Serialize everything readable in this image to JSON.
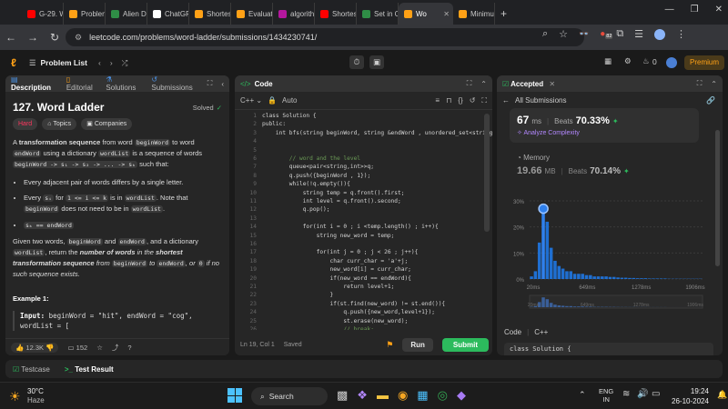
{
  "browser": {
    "tabs": [
      {
        "label": "G-29. W",
        "color": "#ff0000"
      },
      {
        "label": "Problem",
        "color": "#ffa116"
      },
      {
        "label": "Alien Dic",
        "color": "#2f8d46"
      },
      {
        "label": "ChatGPT",
        "color": "#ffffff"
      },
      {
        "label": "Shortest",
        "color": "#ffa116"
      },
      {
        "label": "Evaluati",
        "color": "#ffa116"
      },
      {
        "label": "algorith",
        "color": "#b5179e"
      },
      {
        "label": "Shortest",
        "color": "#ff0000"
      },
      {
        "label": "Set in C",
        "color": "#2f8d46"
      },
      {
        "label": "Wo",
        "color": "#ffa116",
        "active": true
      },
      {
        "label": "Minimu",
        "color": "#ffa116"
      }
    ],
    "url": "leetcode.com/problems/word-ladder/submissions/1434230741/",
    "ext_badge": "82"
  },
  "lc": {
    "problem_list": "Problem List",
    "premium": "Premium",
    "streak": "0"
  },
  "desc": {
    "tabs": [
      "Description",
      "Editorial",
      "Solutions",
      "Submissions"
    ],
    "title": "127. Word Ladder",
    "solved": "Solved",
    "difficulty": "Hard",
    "topics": "Topics",
    "companies": "Companies",
    "p1_a": "A ",
    "p1_b": "transformation sequence",
    "p1_c": " from word ",
    "begin": "beginWord",
    "to_word": " to word",
    "end": "endWord",
    "p1_d": " using a dictionary ",
    "wl": "wordList",
    "p1_e": " is a sequence of words",
    "seq": "beginWord -> s₁ -> s₂ -> ... -> sₖ",
    "such": " such that:",
    "b1": "Every adjacent pair of words differs by a single letter.",
    "b2_a": "Every ",
    "b2_s": "sᵢ",
    "b2_b": " for ",
    "b2_r": "1 <= i <= k",
    "b2_c": " is in ",
    "b2_d": ". Note that",
    "b2_e": " does not need to be in ",
    "b3": "sₖ == endWord",
    "p2_a": "Given two words, ",
    "p2_and": " and ",
    "p2_b": ", and a dictionary",
    "p2_c": ", return the ",
    "p2_bold": "number of words",
    "p2_d": " in the ",
    "p2_bold2": "shortest transformation sequence",
    "p2_e": " from ",
    "p2_f": " to ",
    "p2_g": ", or ",
    "zero": "0",
    "p2_h": " if no such sequence exists.",
    "ex": "Example 1:",
    "ex_in_label": "Input:",
    "ex_in": " beginWord = \"hit\", endWord = \"cog\",",
    "ex_in2": "wordList = [",
    "likes": "12.3K",
    "comments": "152"
  },
  "code": {
    "title": "Code",
    "lang": "C++",
    "auto": "Auto",
    "status_pos": "Ln 19, Col 1",
    "saved": "Saved",
    "run": "Run",
    "submit": "Submit",
    "lines": [
      {
        "n": "1",
        "t": "class Solution {"
      },
      {
        "n": "2",
        "t": "public:"
      },
      {
        "n": "3",
        "t": "    int bfs(string beginWord, string &endWord , unordered_set<string"
      },
      {
        "n": "4",
        "t": ""
      },
      {
        "n": "5",
        "t": ""
      },
      {
        "n": "6",
        "t": "        // word and the level"
      },
      {
        "n": "7",
        "t": "        queue<pair<string,int>>q;"
      },
      {
        "n": "8",
        "t": "        q.push({beginWord , 1});"
      },
      {
        "n": "9",
        "t": "        while(!q.empty()){"
      },
      {
        "n": "10",
        "t": "            string temp = q.front().first;"
      },
      {
        "n": "11",
        "t": "            int level = q.front().second;"
      },
      {
        "n": "12",
        "t": "            q.pop();"
      },
      {
        "n": "13",
        "t": ""
      },
      {
        "n": "14",
        "t": "            for(int i = 0 ; i <temp.length() ; i++){"
      },
      {
        "n": "15",
        "t": "                string new_word = temp;"
      },
      {
        "n": "16",
        "t": ""
      },
      {
        "n": "17",
        "t": "                for(int j = 0 ; j < 26 ; j++){"
      },
      {
        "n": "18",
        "t": "                    char curr_char = 'a'+j;"
      },
      {
        "n": "19",
        "t": "                    new_word[i] = curr_char;"
      },
      {
        "n": "20",
        "t": "                    if(new_word == endWord){"
      },
      {
        "n": "21",
        "t": "                        return level+1;"
      },
      {
        "n": "22",
        "t": "                    }"
      },
      {
        "n": "23",
        "t": "                    if(st.find(new_word) != st.end()){"
      },
      {
        "n": "24",
        "t": "                        q.push({new_word,level+1});"
      },
      {
        "n": "25",
        "t": "                        st.erase(new_word);"
      },
      {
        "n": "26",
        "t": "                        // break;"
      },
      {
        "n": "27",
        "t": "                    }"
      }
    ]
  },
  "result": {
    "tab": "Accepted",
    "all_subs": "All Submissions",
    "runtime_val": "67",
    "runtime_unit": "ms",
    "beats": "Beats",
    "runtime_beats": "70.33%",
    "analyze": "Analyze Complexity",
    "memory": "Memory",
    "mem_val": "19.66",
    "mem_unit": "MB",
    "mem_beats": "70.14%",
    "code_label": "Code",
    "code_lang": "C++",
    "code_preview": "class Solution {"
  },
  "chart_data": {
    "type": "bar",
    "ylim": [
      0,
      30
    ],
    "yticks": [
      "30%",
      "20%",
      "10%",
      "0%"
    ],
    "xticks": [
      "20ms",
      "649ms",
      "1278ms",
      "1906ms"
    ],
    "values": [
      1,
      3,
      14,
      27,
      22,
      12,
      7,
      5,
      4,
      3,
      3,
      2,
      2,
      2,
      1.5,
      1.5,
      1,
      1,
      1,
      1,
      0.8,
      0.8,
      0.6,
      0.5,
      0.5,
      0.4,
      0.4,
      0.3,
      0.3,
      0.3,
      0.2,
      0.2,
      0.2,
      0.2,
      0.2,
      0.1,
      0.1,
      0.1,
      0.1,
      0.1,
      0.1,
      0.1,
      0.1,
      0.1
    ],
    "marker_index": 3,
    "marker_color": "#2f80ed"
  },
  "bottom": {
    "testcase": "Testcase",
    "testresult": "Test Result"
  },
  "taskbar": {
    "temp": "30°C",
    "weather": "Haze",
    "search": "Search",
    "lang1": "ENG",
    "lang2": "IN",
    "time": "19:24",
    "date": "26-10-2024"
  }
}
